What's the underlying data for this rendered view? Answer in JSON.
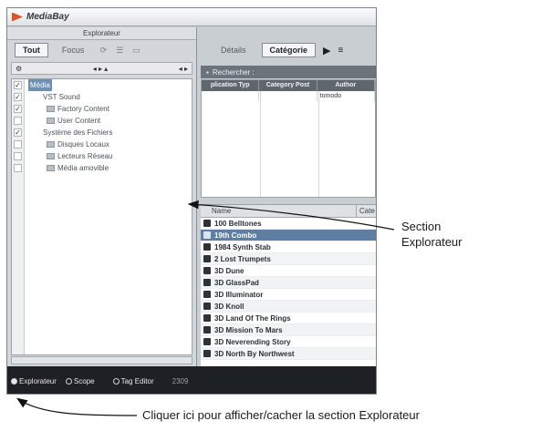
{
  "window": {
    "title": "MediaBay"
  },
  "explorer": {
    "header": "Explorateur",
    "tabs": [
      {
        "label": "Tout"
      },
      {
        "label": "Focus"
      }
    ],
    "tree": [
      {
        "label": "Média",
        "checked": true,
        "indent": 0
      },
      {
        "label": "VST Sound",
        "checked": true,
        "indent": 1
      },
      {
        "label": "Factory Content",
        "checked": true,
        "indent": 2
      },
      {
        "label": "User Content",
        "checked": false,
        "indent": 2
      },
      {
        "label": "Système des Fichiers",
        "checked": true,
        "indent": 1
      },
      {
        "label": "Disques Locaux",
        "checked": false,
        "indent": 2
      },
      {
        "label": "Lecteurs Réseau",
        "checked": false,
        "indent": 2
      },
      {
        "label": "Média amovible",
        "checked": false,
        "indent": 2
      }
    ]
  },
  "right": {
    "tabs": [
      {
        "label": "Détails"
      },
      {
        "label": "Catégorie"
      }
    ],
    "search_label": "Rechercher :",
    "attr_columns": [
      "plication Typ",
      "Category Post",
      "Author"
    ],
    "attr_rows": [
      [
        "",
        "",
        "tomodo"
      ]
    ],
    "results_header": {
      "name": "Name",
      "category": "Cate"
    },
    "results": [
      "100 Belltones",
      "19th Combo",
      "1984 Synth Stab",
      "2 Lost Trumpets",
      "3D Dune",
      "3D GlassPad",
      "3D Illuminator",
      "3D Knoll",
      "3D Land Of The Rings",
      "3D Mission To Mars",
      "3D Neverending Story",
      "3D North By Northwest"
    ],
    "selected_result": 1
  },
  "bottom_bar": {
    "explorer_label": "Explorateur",
    "scope_label": "Scope",
    "tag_editor_label": "Tag Editor",
    "count": "2309"
  },
  "annotations": {
    "section": [
      "Section",
      "Explorateur"
    ],
    "footer": "Cliquer ici pour afficher/cacher la section Explorateur"
  }
}
